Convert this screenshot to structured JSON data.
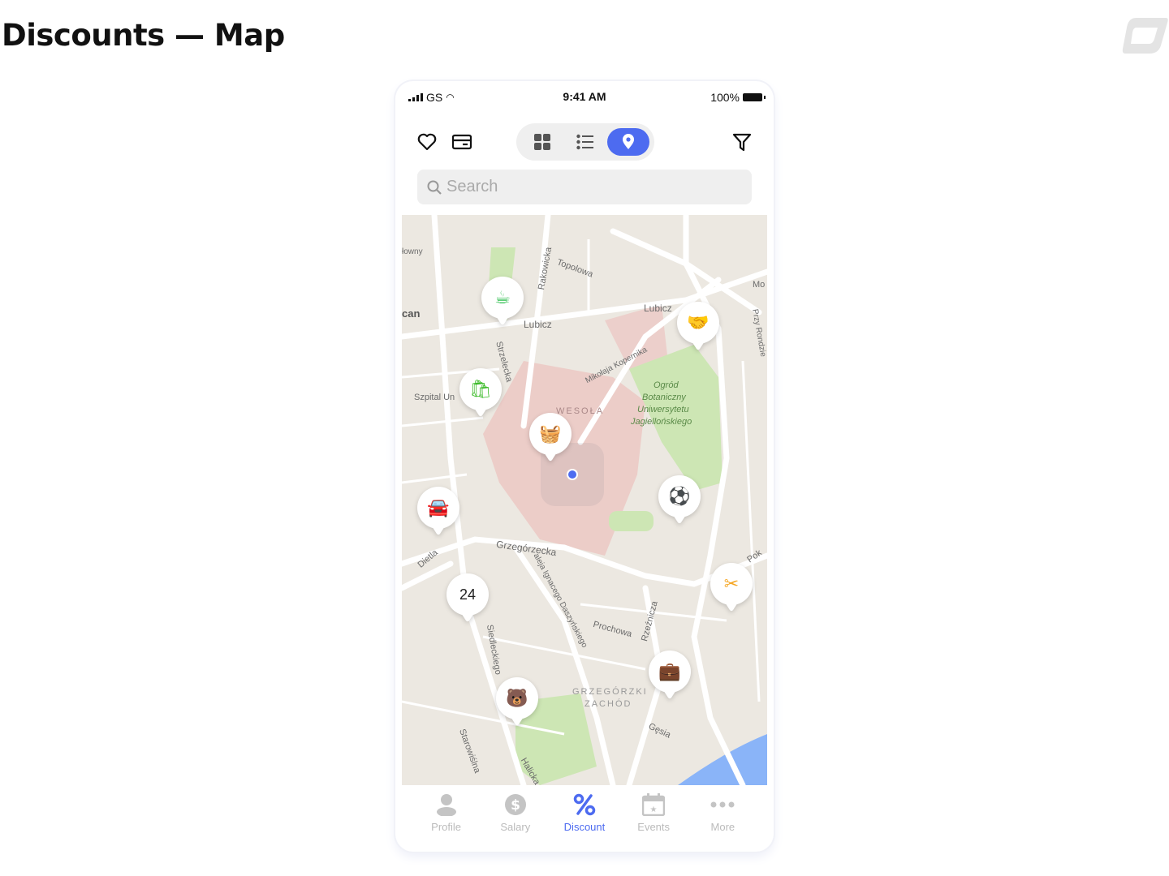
{
  "page_title": "Discounts — Map",
  "status": {
    "carrier": "GS",
    "time": "9:41 AM",
    "battery": "100%"
  },
  "header": {
    "favorites_icon": "heart-icon",
    "card_icon": "card-icon",
    "filter_icon": "filter-icon",
    "view_modes": [
      {
        "name": "grid",
        "icon": "grid-icon"
      },
      {
        "name": "list",
        "icon": "list-icon"
      },
      {
        "name": "map",
        "icon": "map-pin-icon",
        "active": true
      }
    ]
  },
  "search": {
    "placeholder": "Search",
    "value": ""
  },
  "map": {
    "labels": [
      "Topolowa",
      "Rakowicka",
      "Lubicz",
      "Lubicz",
      "Strzelecka",
      "Mikołaja Kopernika",
      "Ogród",
      "Botaniczny",
      "Uniwersytetu",
      "Jagiellońskiego",
      "WESOŁA",
      "Szpital Un",
      "Grzegórzecka",
      "Dietla",
      "aleja Ignacego Daszyńskiego",
      "Prochowa",
      "Rzeźnicza",
      "Siedleckiego",
      "GRZEGÓRZKI",
      "ZACHÓD",
      "Gęsia",
      "Starowiślna",
      "Halicka",
      "Pok",
      "Mo",
      "Przy Rondzie",
      "łowny",
      "can"
    ],
    "pins": [
      {
        "icon": "coffee-cup-icon",
        "color": "#2fbf4f",
        "glyph": "☕"
      },
      {
        "icon": "handshake-icon",
        "color": "#4d6bf0",
        "glyph": "🤝"
      },
      {
        "icon": "shopping-bag-icon",
        "color": "#3dbb2a",
        "glyph": "🛍"
      },
      {
        "icon": "basket-icon",
        "color": "#f57c1f",
        "glyph": "🧺"
      },
      {
        "icon": "car-icon",
        "color": "#29b6e0",
        "glyph": "🚘"
      },
      {
        "icon": "soccer-ball-icon",
        "color": "#4d6bf0",
        "glyph": "⚽"
      },
      {
        "icon": "scissors-icon",
        "color": "#f5a623",
        "glyph": "✂"
      },
      {
        "icon": "cluster",
        "label": "24"
      },
      {
        "icon": "suitcase-icon",
        "color": "#f57c1f",
        "glyph": "💼"
      },
      {
        "icon": "bear-icon",
        "color": "#ff3da8",
        "glyph": "🐻"
      }
    ]
  },
  "tabbar": [
    {
      "label": "Profile",
      "icon": "person-icon"
    },
    {
      "label": "Salary",
      "icon": "dollar-icon"
    },
    {
      "label": "Discount",
      "icon": "percent-icon",
      "active": true
    },
    {
      "label": "Events",
      "icon": "calendar-star-icon"
    },
    {
      "label": "More",
      "icon": "more-dots-icon"
    }
  ],
  "colors": {
    "accent": "#4d6bf0",
    "inactive": "#bbbbbb",
    "map_bg": "#ece8e1",
    "park": "#cde6b4",
    "district": "#ecc5c2",
    "water": "#8ab4f8"
  }
}
